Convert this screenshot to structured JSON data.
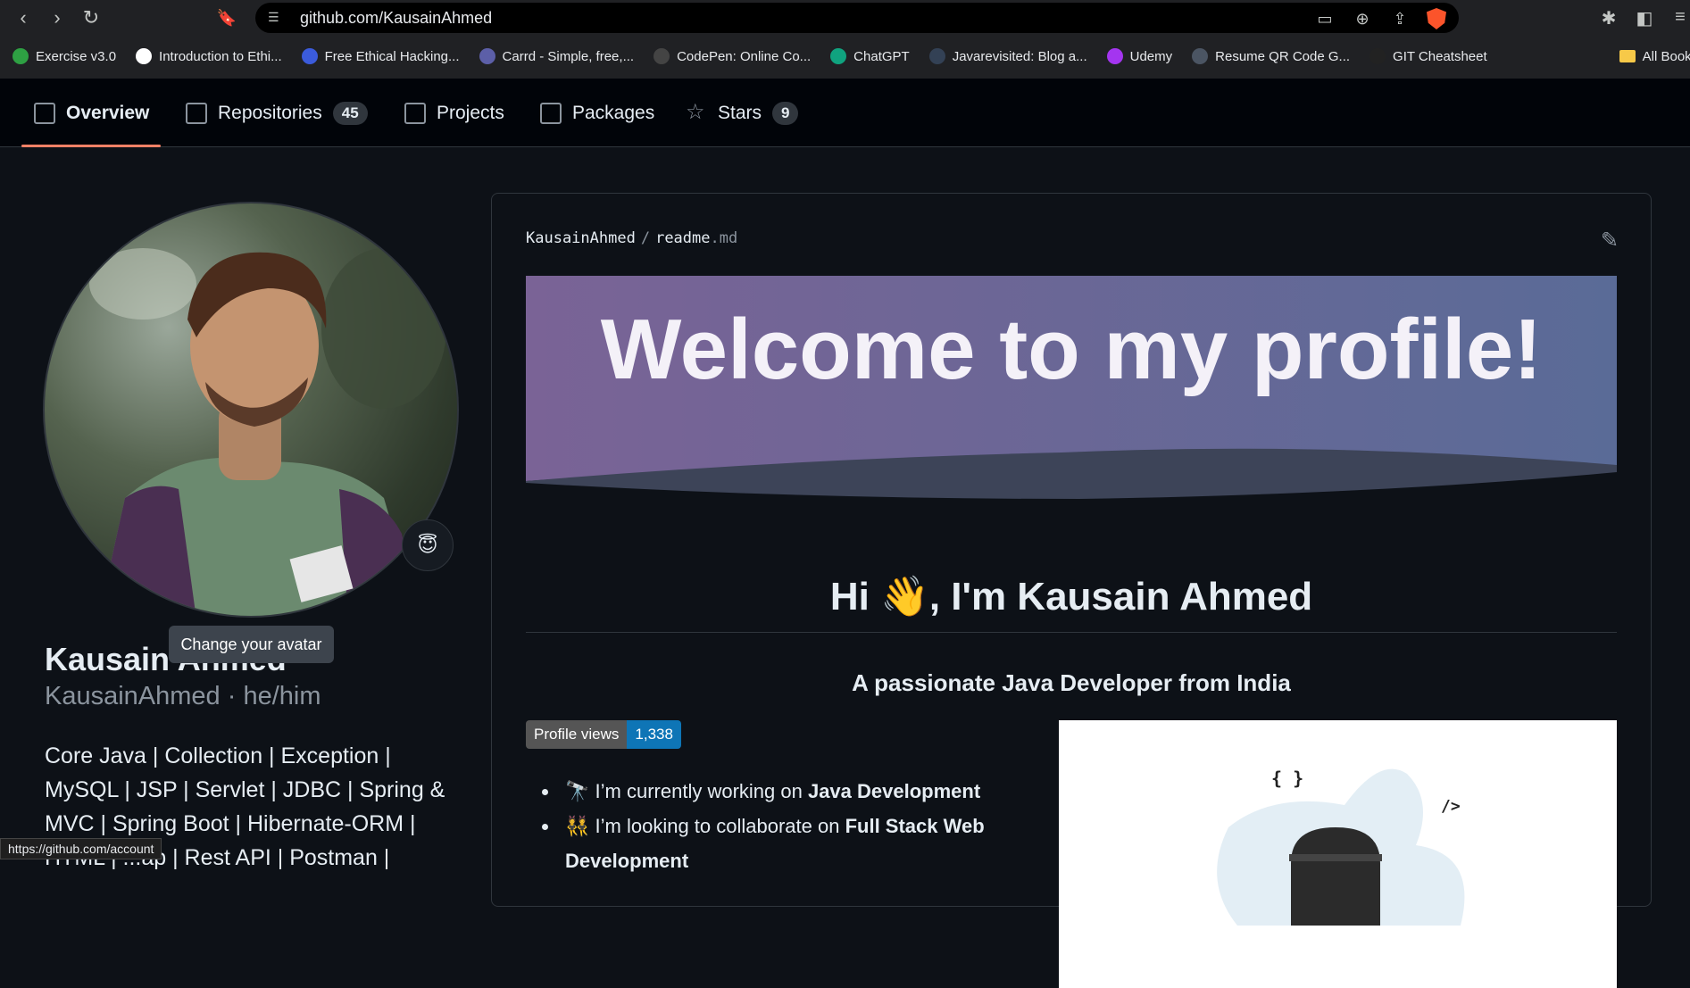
{
  "browser": {
    "url_host": "github.com",
    "url_path": "/KausainAhmed",
    "bookmarks": [
      {
        "label": "Exercise v3.0",
        "icon": "w-icon",
        "color": "#2ea043"
      },
      {
        "label": "Introduction to Ethi...",
        "icon": "google-icon",
        "color": "#ffffff"
      },
      {
        "label": "Free Ethical Hacking...",
        "icon": "globe-icon",
        "color": "#3b5bdb"
      },
      {
        "label": "Carrd - Simple, free,...",
        "icon": "carrd-icon",
        "color": "#5c5fa8"
      },
      {
        "label": "CodePen: Online Co...",
        "icon": "codepen-icon",
        "color": "#444444"
      },
      {
        "label": "ChatGPT",
        "icon": "chatgpt-icon",
        "color": "#10a37f"
      },
      {
        "label": "Javarevisited: Blog a...",
        "icon": "blog-icon",
        "color": "#334155"
      },
      {
        "label": "Udemy",
        "icon": "udemy-icon",
        "color": "#a435f0"
      },
      {
        "label": "Resume QR Code G...",
        "icon": "qr-icon",
        "color": "#4b5563"
      },
      {
        "label": "GIT Cheatsheet",
        "icon": "question-icon",
        "color": "#222222"
      }
    ],
    "all_bookmarks": "All Bookmark",
    "status_url": "https://github.com/account"
  },
  "nav": {
    "tabs": [
      {
        "label": "Overview",
        "icon": "book-icon"
      },
      {
        "label": "Repositories",
        "icon": "repo-icon",
        "count": "45"
      },
      {
        "label": "Projects",
        "icon": "table-icon"
      },
      {
        "label": "Packages",
        "icon": "package-icon"
      },
      {
        "label": "Stars",
        "icon": "star-icon",
        "count": "9"
      }
    ]
  },
  "profile": {
    "tooltip": "Change your avatar",
    "name": "Kausain Ahmed",
    "username_line": "KausainAhmed · he/him",
    "bio": "Core Java | Collection | Exception | MySQL | JSP | Servlet | JDBC | Spring & MVC | Spring Boot | Hibernate-ORM | HTML | ...ap | Rest API | Postman |",
    "status_emoji": "😇"
  },
  "readme": {
    "owner": "KausainAhmed",
    "file": "readme",
    "ext": ".md",
    "banner_text": "Welcome to my profile!",
    "heading": "Hi 👋, I'm Kausain Ahmed",
    "tagline": "A passionate Java Developer from India",
    "badge_label": "Profile views",
    "badge_value": "1,338",
    "bullets": [
      {
        "emoji": "🔭",
        "text": "I’m currently working on ",
        "bold": "Java Development"
      },
      {
        "emoji": "👯",
        "text": "I’m looking to collaborate on ",
        "bold": "Full Stack Web Development"
      }
    ],
    "illustration_symbols": [
      "{ }",
      "/>"
    ]
  }
}
